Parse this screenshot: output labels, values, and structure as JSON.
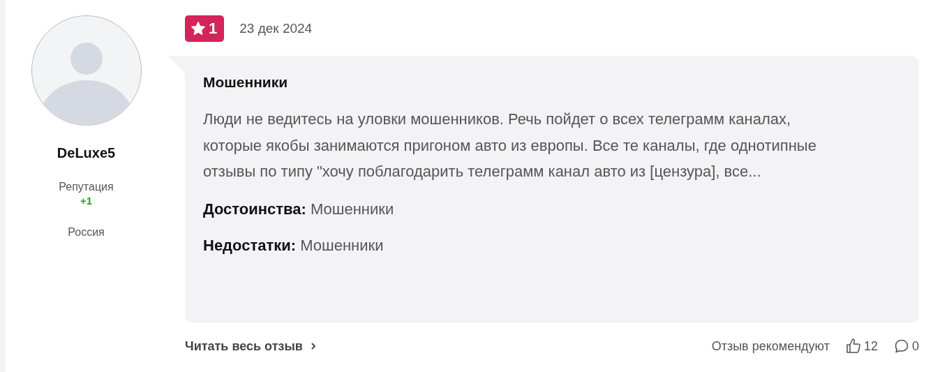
{
  "author": {
    "name": "DeLuxe5",
    "reputation_label": "Репутация",
    "reputation": "+1",
    "country": "Россия"
  },
  "review": {
    "rating": "1",
    "date": "23 дек 2024",
    "title": "Мошенники",
    "text": "Люди не ведитесь на уловки мошенников. Речь пойдет о всех телеграмм каналах, которые якобы занимаются пригоном авто из европы. Все те каналы, где однотипные отзывы по типу \"хочу поблагодарить телеграмм канал авто из [цензура], все...",
    "pros_label": "Достоинства:",
    "pros": "Мошенники",
    "cons_label": "Недостатки:",
    "cons": "Мошенники"
  },
  "footer": {
    "read_more": "Читать весь отзыв",
    "recommend_label": "Отзыв рекомендуют",
    "likes": "12",
    "comments": "0"
  }
}
